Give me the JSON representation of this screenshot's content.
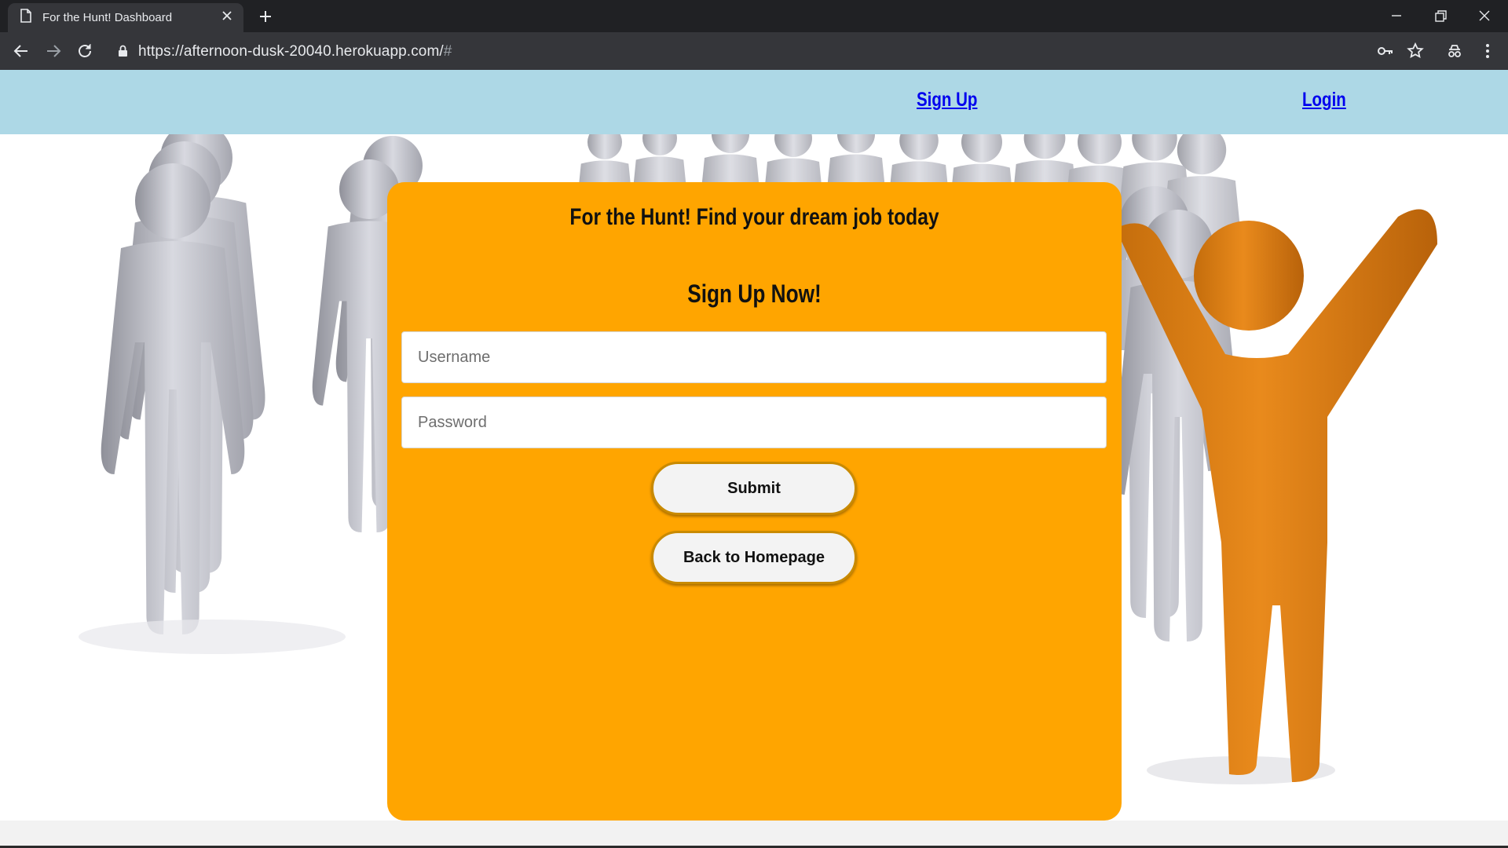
{
  "browser": {
    "tab_title": "For the Hunt! Dashboard",
    "url_main": "https://afternoon-dusk-20040.herokuapp.com/",
    "url_hash": "#",
    "icons": [
      "page-icon",
      "close-icon",
      "plus-icon",
      "minimize-icon",
      "restore-icon",
      "close-window-icon",
      "back-arrow-icon",
      "forward-arrow-icon",
      "reload-icon",
      "lock-icon",
      "key-icon",
      "star-icon",
      "incognito-extension-icon",
      "more-menu-icon"
    ]
  },
  "nav": {
    "signup_label": "Sign Up",
    "login_label": "Login"
  },
  "card": {
    "title": "For the Hunt! Find your dream job today",
    "subtitle": "Sign Up Now!",
    "username_placeholder": "Username",
    "password_placeholder": "Password",
    "submit_label": "Submit",
    "back_label": "Back to Homepage"
  },
  "colors": {
    "header_bg": "#add8e6",
    "card_bg": "#ffa500",
    "link": "#0000ee"
  }
}
